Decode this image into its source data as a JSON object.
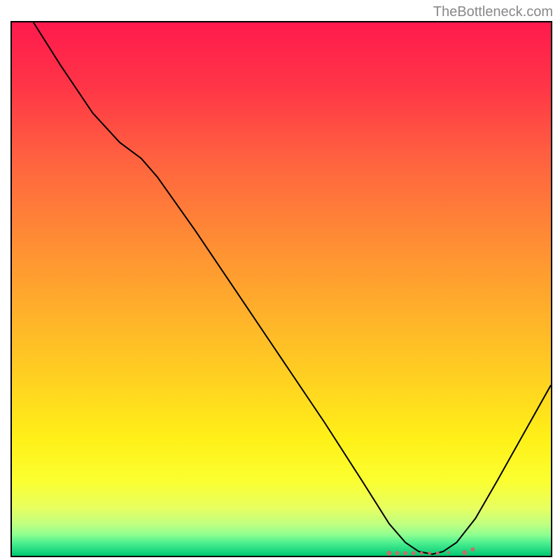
{
  "watermark": "TheBottleneck.com",
  "chart_data": {
    "type": "line",
    "title": "",
    "xlabel": "",
    "ylabel": "",
    "xlim": [
      0,
      100
    ],
    "ylim": [
      0,
      100
    ],
    "gradient_stops": [
      {
        "offset": 0,
        "color": "#ff1a4d"
      },
      {
        "offset": 0.12,
        "color": "#ff3547"
      },
      {
        "offset": 0.25,
        "color": "#ff6040"
      },
      {
        "offset": 0.4,
        "color": "#ff8a35"
      },
      {
        "offset": 0.55,
        "color": "#ffb22a"
      },
      {
        "offset": 0.68,
        "color": "#ffd420"
      },
      {
        "offset": 0.78,
        "color": "#fff018"
      },
      {
        "offset": 0.86,
        "color": "#fbff30"
      },
      {
        "offset": 0.91,
        "color": "#e8ff60"
      },
      {
        "offset": 0.94,
        "color": "#c0ff80"
      },
      {
        "offset": 0.96,
        "color": "#90ff90"
      },
      {
        "offset": 0.975,
        "color": "#50f090"
      },
      {
        "offset": 0.99,
        "color": "#20d880"
      },
      {
        "offset": 1.0,
        "color": "#00c870"
      }
    ],
    "series": [
      {
        "name": "bottleneck-curve",
        "type": "line",
        "points": [
          {
            "x": 4,
            "y": 100
          },
          {
            "x": 9,
            "y": 92
          },
          {
            "x": 15,
            "y": 83
          },
          {
            "x": 20,
            "y": 77.5
          },
          {
            "x": 24,
            "y": 74.5
          },
          {
            "x": 27,
            "y": 71
          },
          {
            "x": 34,
            "y": 61
          },
          {
            "x": 42,
            "y": 49
          },
          {
            "x": 50,
            "y": 37
          },
          {
            "x": 58,
            "y": 25
          },
          {
            "x": 65,
            "y": 14
          },
          {
            "x": 70,
            "y": 6
          },
          {
            "x": 73,
            "y": 2.5
          },
          {
            "x": 75.5,
            "y": 0.8
          },
          {
            "x": 78,
            "y": 0.3
          },
          {
            "x": 80,
            "y": 0.8
          },
          {
            "x": 82.5,
            "y": 2.5
          },
          {
            "x": 86,
            "y": 7
          },
          {
            "x": 90,
            "y": 14
          },
          {
            "x": 95,
            "y": 23
          },
          {
            "x": 100,
            "y": 32
          }
        ]
      },
      {
        "name": "data-points",
        "type": "scatter",
        "points": [
          {
            "x": 70,
            "y": 0.5,
            "r": 3.5
          },
          {
            "x": 71.5,
            "y": 0.5,
            "r": 3
          },
          {
            "x": 73,
            "y": 0.5,
            "r": 3
          },
          {
            "x": 74.5,
            "y": 0.5,
            "r": 3
          },
          {
            "x": 76,
            "y": 0.5,
            "r": 2.5
          },
          {
            "x": 77.5,
            "y": 0.5,
            "r": 2.5
          },
          {
            "x": 79,
            "y": 0.5,
            "r": 2.5
          },
          {
            "x": 81,
            "y": 0.6,
            "r": 2
          },
          {
            "x": 84,
            "y": 0.6,
            "r": 3.5
          },
          {
            "x": 85.5,
            "y": 1.2,
            "r": 3
          }
        ]
      }
    ]
  }
}
